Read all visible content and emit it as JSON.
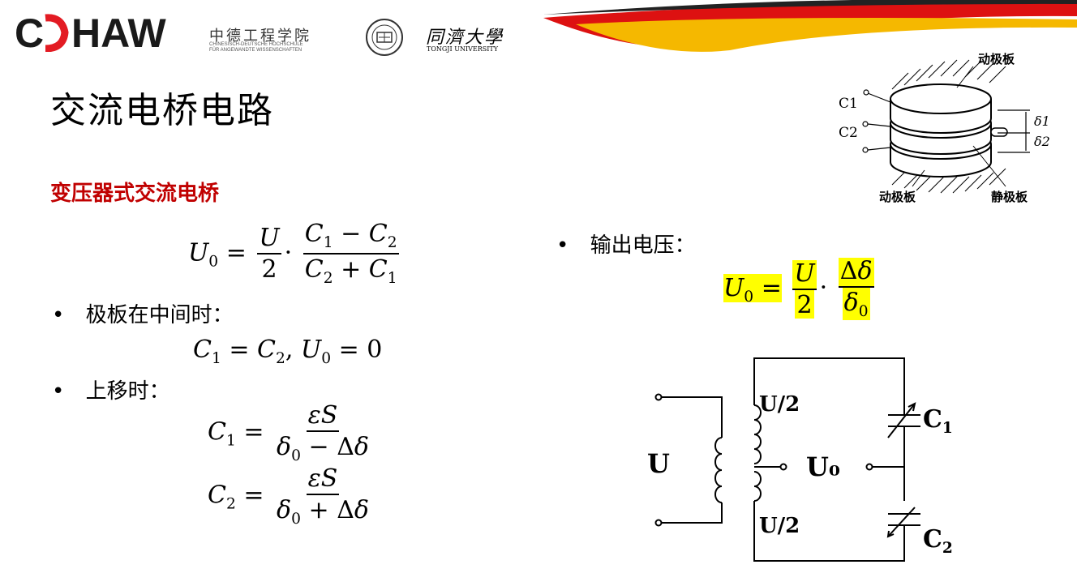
{
  "header": {
    "logo_cdhaw": "CDHAW",
    "cdhaw_cn": "中德工程学院",
    "cdhaw_de_1": "CHINESISCH-DEUTSCHE HOCHSCHULE",
    "cdhaw_de_2": "FÜR ANGEWANDTE WISSENSCHAFTEN",
    "tongji_cn": "同濟大學",
    "tongji_en": "TONGJI UNIVERSITY",
    "tongji_seal": "1907 TONGJI UNIVERSITY"
  },
  "title": "交流电桥电路",
  "subtitle": "变压器式交流电桥",
  "left": {
    "bullet1": "极板在中间时：",
    "bullet2": "上移时："
  },
  "right": {
    "bullet1": "输出电压："
  },
  "capacitor_diagram": {
    "top_label": "动极板",
    "bottom_left_label": "动极板",
    "bottom_right_label": "静极板",
    "c1": "C1",
    "c2": "C2",
    "delta1": "δ1",
    "delta2": "δ2"
  },
  "circuit": {
    "input_label": "U",
    "half_top": "U/2",
    "half_bottom": "U/2",
    "output_label": "U₀",
    "c1_label": "C",
    "c1_sub": "1",
    "c2_label": "C",
    "c2_sub": "2"
  },
  "colors": {
    "subtitle_red": "#c00000",
    "highlight": "#ffff00",
    "flag_red": "#dd1111",
    "flag_gold": "#f5b800",
    "logo_red": "#e31b23"
  }
}
